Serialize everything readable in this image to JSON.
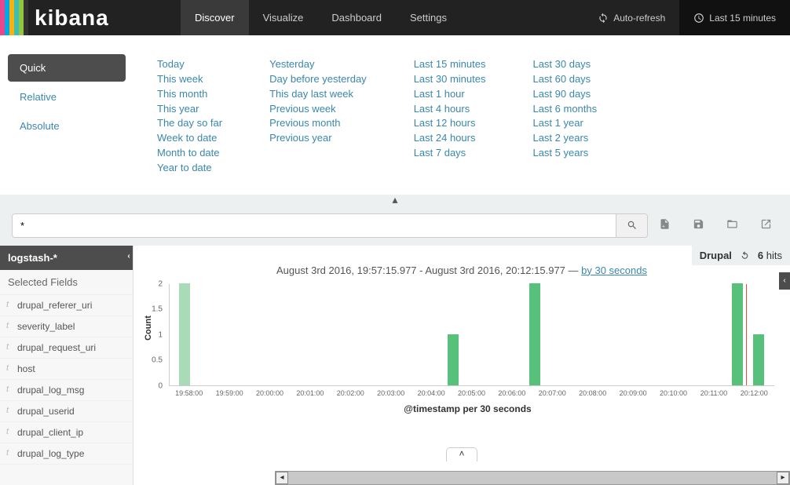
{
  "brand": {
    "name": "kibana",
    "stripes": [
      "#e8488b",
      "#00a9e5",
      "#f9b110",
      "#3ebeb0",
      "#90c73e",
      "#333333"
    ]
  },
  "nav": {
    "items": [
      "Discover",
      "Visualize",
      "Dashboard",
      "Settings"
    ],
    "active": 0,
    "autorefresh": "Auto-refresh",
    "timerange": "Last 15 minutes"
  },
  "time_modes": [
    "Quick",
    "Relative",
    "Absolute"
  ],
  "time_cols": [
    [
      "Today",
      "This week",
      "This month",
      "This year",
      "The day so far",
      "Week to date",
      "Month to date",
      "Year to date"
    ],
    [
      "Yesterday",
      "Day before yesterday",
      "This day last week",
      "Previous week",
      "Previous month",
      "Previous year"
    ],
    [
      "Last 15 minutes",
      "Last 30 minutes",
      "Last 1 hour",
      "Last 4 hours",
      "Last 12 hours",
      "Last 24 hours",
      "Last 7 days"
    ],
    [
      "Last 30 days",
      "Last 60 days",
      "Last 90 days",
      "Last 6 months",
      "Last 1 year",
      "Last 2 years",
      "Last 5 years"
    ]
  ],
  "search": {
    "value": "*"
  },
  "index_pattern": "logstash-*",
  "selected_fields_title": "Selected Fields",
  "selected_fields": [
    "drupal_referer_uri",
    "severity_label",
    "drupal_request_uri",
    "host",
    "drupal_log_msg",
    "drupal_userid",
    "drupal_client_ip",
    "drupal_log_type"
  ],
  "badge": {
    "label": "Drupal",
    "hits_count": "6",
    "hits_word": "hits"
  },
  "chart_title": {
    "range": "August 3rd 2016, 19:57:15.977 - August 3rd 2016, 20:12:15.977 — ",
    "interval": "by 30 seconds"
  },
  "chart_data": {
    "type": "bar",
    "xlabel": "@timestamp per 30 seconds",
    "ylabel": "Count",
    "ylim": [
      0,
      2
    ],
    "yticks": [
      0,
      0.5,
      1,
      1.5,
      2
    ],
    "x_tick_labels": [
      "19:58:00",
      "19:59:00",
      "20:00:00",
      "20:01:00",
      "20:02:00",
      "20:03:00",
      "20:04:00",
      "20:05:00",
      "20:06:00",
      "20:07:00",
      "20:08:00",
      "20:09:00",
      "20:10:00",
      "20:11:00",
      "20:12:00"
    ],
    "bars": [
      {
        "x_pct": 1.5,
        "count": 2,
        "brush": true
      },
      {
        "x_pct": 46.0,
        "count": 1
      },
      {
        "x_pct": 59.5,
        "count": 2
      },
      {
        "x_pct": 93.0,
        "count": 2
      },
      {
        "x_pct": 96.5,
        "count": 1
      }
    ],
    "marker_pct": 95.3
  }
}
